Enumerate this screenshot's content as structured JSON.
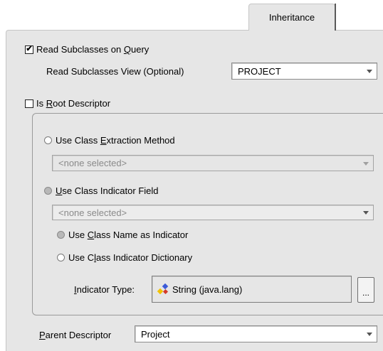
{
  "tab": {
    "label": "Inheritance"
  },
  "read_subclasses": {
    "checked": true,
    "label_pre": "Read Subclasses on ",
    "label_mn": "Q",
    "label_post": "uery"
  },
  "read_subclasses_view": {
    "label": "Read Subclasses View (Optional)",
    "value": "PROJECT"
  },
  "is_root": {
    "checked": false,
    "label_pre": "Is ",
    "label_mn": "R",
    "label_post": "oot Descriptor"
  },
  "extraction": {
    "label_pre": "Use Class ",
    "label_mn": "E",
    "label_post": "xtraction Method",
    "selected": false,
    "combo_value": "<none selected>"
  },
  "indicator_field": {
    "label_pre": "",
    "label_mn": "U",
    "label_post": "se Class Indicator Field",
    "selected": true,
    "combo_value": "<none selected>"
  },
  "class_name_indicator": {
    "label_pre": "Use ",
    "label_mn": "C",
    "label_post": "lass Name as Indicator",
    "selected": true
  },
  "indicator_dictionary": {
    "label_pre": "Use C",
    "label_mn": "l",
    "label_post": "ass Indicator Dictionary",
    "selected": false
  },
  "indicator_type": {
    "label_pre": "",
    "label_mn": "I",
    "label_post": "ndicator Type:",
    "value": "String (java.lang)",
    "icon": "java-class-icon",
    "browse_label": "..."
  },
  "parent_descriptor": {
    "label_pre": "",
    "label_mn": "P",
    "label_post": "arent Descriptor",
    "value": "Project"
  }
}
